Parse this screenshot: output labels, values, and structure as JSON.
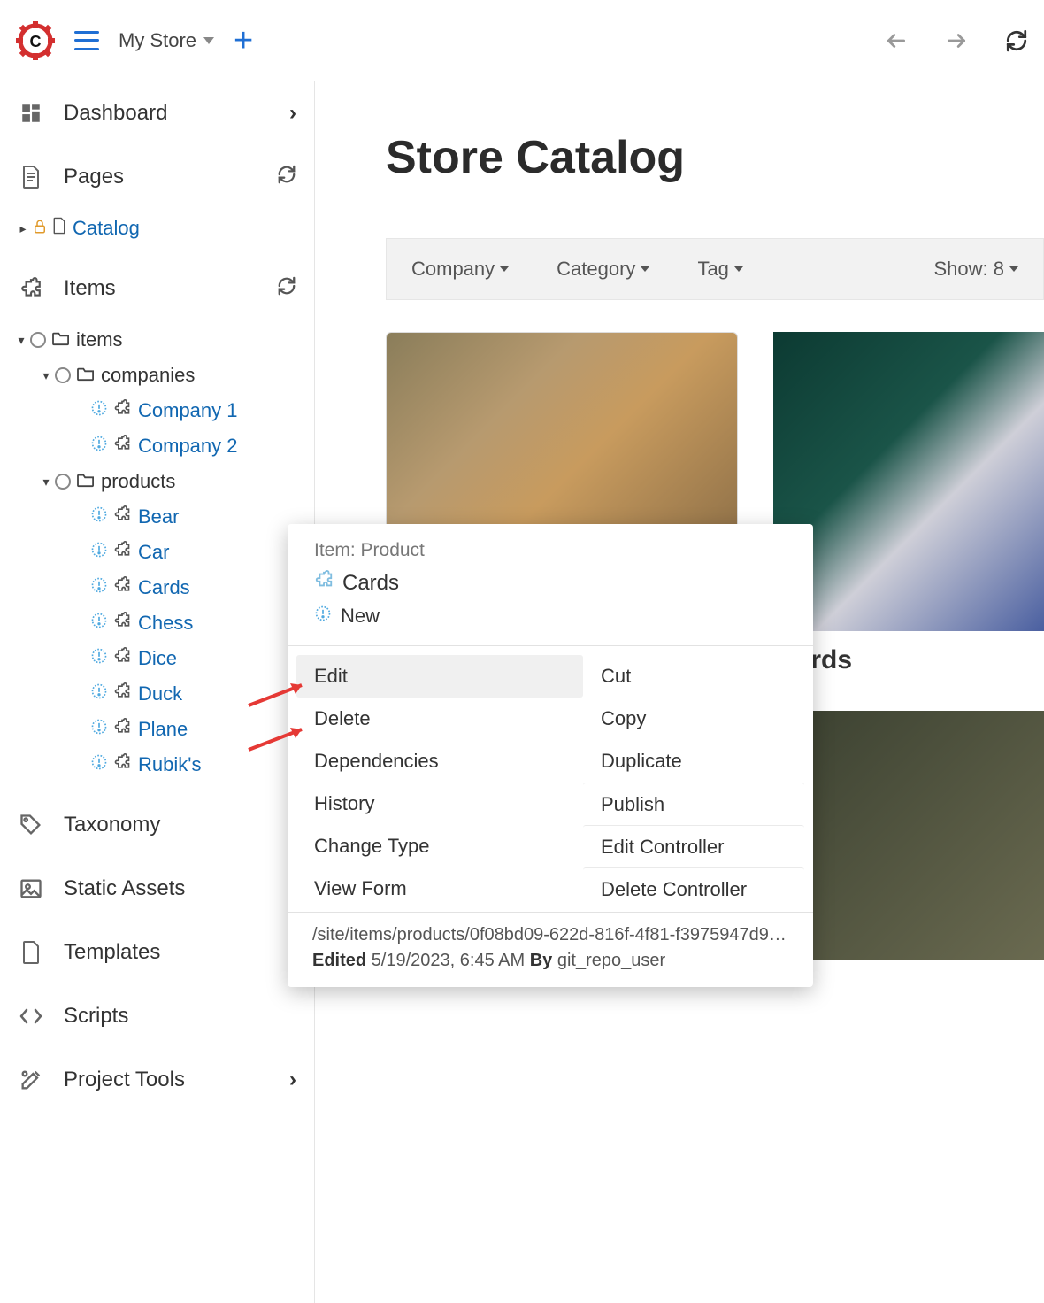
{
  "topbar": {
    "site_name": "My Store"
  },
  "sidebar": {
    "dashboard": "Dashboard",
    "pages": "Pages",
    "catalog": "Catalog",
    "items": "Items",
    "tree": {
      "items": "items",
      "companies": "companies",
      "company1": "Company 1",
      "company2": "Company 2",
      "products": "products",
      "bear": "Bear",
      "car": "Car",
      "cards": "Cards",
      "chess": "Chess",
      "dice": "Dice",
      "duck": "Duck",
      "plane": "Plane",
      "rubiks": "Rubik's"
    },
    "taxonomy": "Taxonomy",
    "static_assets": "Static Assets",
    "templates": "Templates",
    "scripts": "Scripts",
    "project_tools": "Project Tools"
  },
  "main": {
    "title": "Store Catalog",
    "filters": {
      "company": "Company",
      "category": "Category",
      "tag": "Tag",
      "show": "Show: 8"
    },
    "cards": {
      "card2_label": "Cards"
    }
  },
  "ctx": {
    "type_label": "Item: Product",
    "name": "Cards",
    "status": "New",
    "col1": {
      "edit": "Edit",
      "delete": "Delete",
      "dependencies": "Dependencies",
      "history": "History",
      "change_type": "Change Type",
      "view_form": "View Form"
    },
    "col2": {
      "cut": "Cut",
      "copy": "Copy",
      "duplicate": "Duplicate",
      "publish": "Publish",
      "edit_controller": "Edit Controller",
      "delete_controller": "Delete Controller"
    },
    "path": "/site/items/products/0f08bd09-622d-816f-4f81-f3975947d9…",
    "edited_label": "Edited",
    "edited_value": "5/19/2023, 6:45 AM",
    "by_label": "By",
    "by_value": "git_repo_user"
  }
}
